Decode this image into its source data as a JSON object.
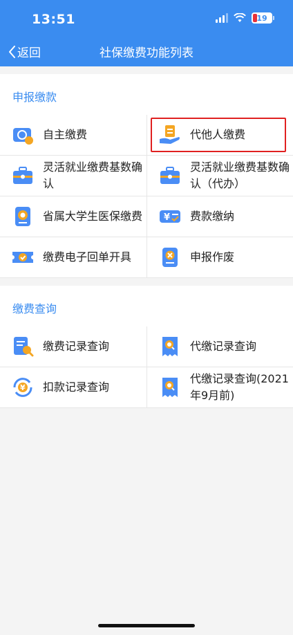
{
  "status": {
    "time": "13:51",
    "battery": "19"
  },
  "nav": {
    "back_label": "返回",
    "title": "社保缴费功能列表"
  },
  "sections": [
    {
      "title": "申报缴款",
      "items": [
        {
          "label": "自主缴费",
          "icon": "card-payment-icon"
        },
        {
          "label": "代他人缴费",
          "icon": "hand-document-icon"
        },
        {
          "label": "灵活就业缴费基数确认",
          "icon": "briefcase-icon"
        },
        {
          "label": "灵活就业缴费基数确认（代办）",
          "icon": "briefcase-icon"
        },
        {
          "label": "省属大学生医保缴费",
          "icon": "badge-icon"
        },
        {
          "label": "费款缴纳",
          "icon": "yuan-card-icon"
        },
        {
          "label": "缴费电子回单开具",
          "icon": "ticket-check-icon"
        },
        {
          "label": "申报作废",
          "icon": "cancel-document-icon"
        }
      ]
    },
    {
      "title": "缴费查询",
      "items": [
        {
          "label": "缴费记录查询",
          "icon": "document-search-icon"
        },
        {
          "label": "代缴记录查询",
          "icon": "receipt-search-icon"
        },
        {
          "label": "扣款记录查询",
          "icon": "yuan-refresh-icon"
        },
        {
          "label": "代缴记录查询(2021年9月前)",
          "icon": "receipt-search-icon"
        }
      ]
    }
  ],
  "colors": {
    "brand": "#3a8cf0",
    "highlight": "#e02020"
  }
}
